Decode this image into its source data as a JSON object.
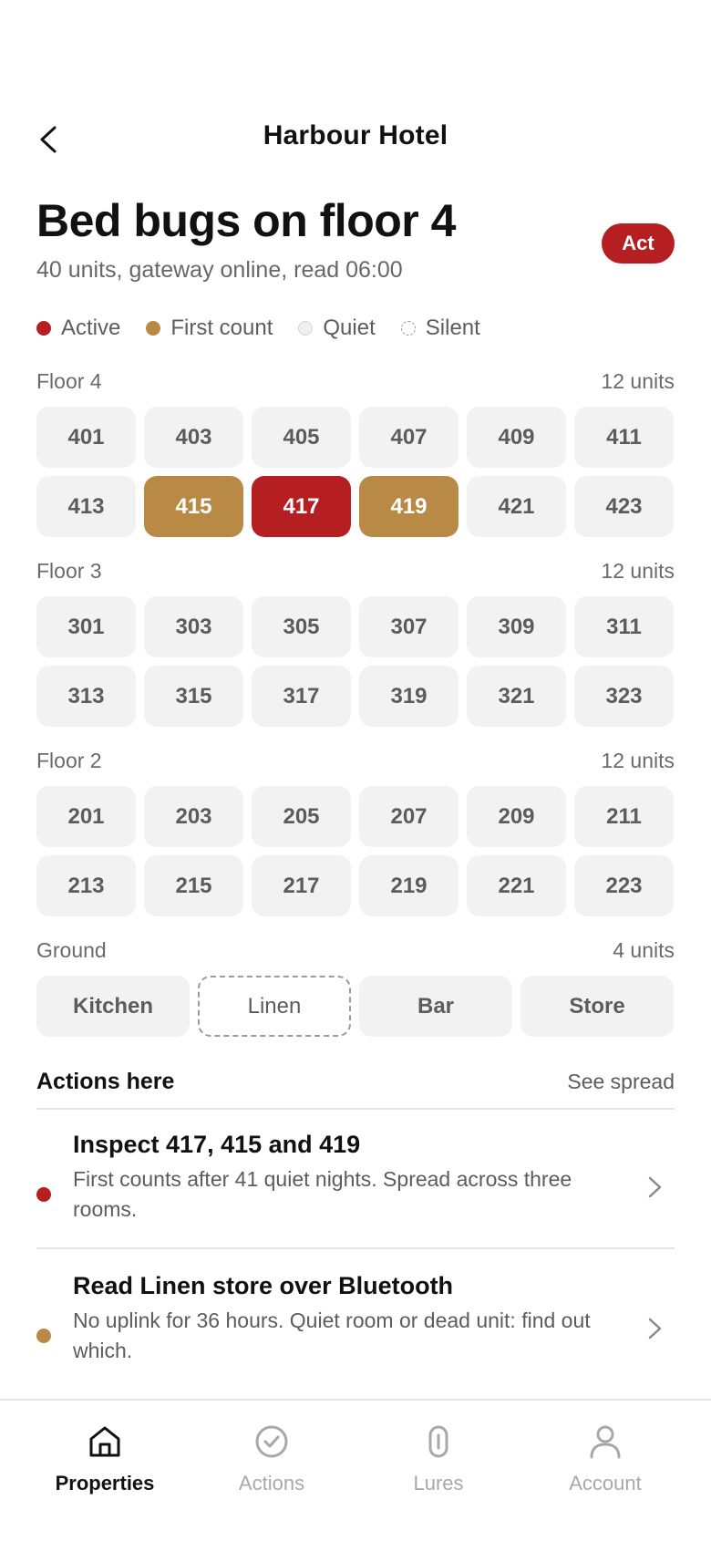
{
  "header": {
    "hotel_name": "Harbour Hotel",
    "title": "Bed bugs on floor 4",
    "subtitle": "40 units, gateway online, read 06:00",
    "badge": "Act",
    "badge_color": "#b51f22"
  },
  "legend": [
    {
      "label": "Active",
      "status": "active",
      "color": "#b51f22"
    },
    {
      "label": "First count",
      "status": "first",
      "color": "#b88a45"
    },
    {
      "label": "Quiet",
      "status": "quiet",
      "color": "#efefef"
    },
    {
      "label": "Silent",
      "status": "silent",
      "color": "#ffffff"
    }
  ],
  "floors": [
    {
      "name": "Floor 4",
      "units": "12 units",
      "rooms": [
        {
          "label": "401",
          "status": "quiet"
        },
        {
          "label": "403",
          "status": "quiet"
        },
        {
          "label": "405",
          "status": "quiet"
        },
        {
          "label": "407",
          "status": "quiet"
        },
        {
          "label": "409",
          "status": "quiet"
        },
        {
          "label": "411",
          "status": "quiet"
        },
        {
          "label": "413",
          "status": "quiet"
        },
        {
          "label": "415",
          "status": "first"
        },
        {
          "label": "417",
          "status": "active"
        },
        {
          "label": "419",
          "status": "first"
        },
        {
          "label": "421",
          "status": "quiet"
        },
        {
          "label": "423",
          "status": "quiet"
        }
      ]
    },
    {
      "name": "Floor 3",
      "units": "12 units",
      "rooms": [
        {
          "label": "301",
          "status": "quiet"
        },
        {
          "label": "303",
          "status": "quiet"
        },
        {
          "label": "305",
          "status": "quiet"
        },
        {
          "label": "307",
          "status": "quiet"
        },
        {
          "label": "309",
          "status": "quiet"
        },
        {
          "label": "311",
          "status": "quiet"
        },
        {
          "label": "313",
          "status": "quiet"
        },
        {
          "label": "315",
          "status": "quiet"
        },
        {
          "label": "317",
          "status": "quiet"
        },
        {
          "label": "319",
          "status": "quiet"
        },
        {
          "label": "321",
          "status": "quiet"
        },
        {
          "label": "323",
          "status": "quiet"
        }
      ]
    },
    {
      "name": "Floor 2",
      "units": "12 units",
      "rooms": [
        {
          "label": "201",
          "status": "quiet"
        },
        {
          "label": "203",
          "status": "quiet"
        },
        {
          "label": "205",
          "status": "quiet"
        },
        {
          "label": "207",
          "status": "quiet"
        },
        {
          "label": "209",
          "status": "quiet"
        },
        {
          "label": "211",
          "status": "quiet"
        },
        {
          "label": "213",
          "status": "quiet"
        },
        {
          "label": "215",
          "status": "quiet"
        },
        {
          "label": "217",
          "status": "quiet"
        },
        {
          "label": "219",
          "status": "quiet"
        },
        {
          "label": "221",
          "status": "quiet"
        },
        {
          "label": "223",
          "status": "quiet"
        }
      ]
    },
    {
      "name": "Ground",
      "units": "4 units",
      "rooms": [
        {
          "label": "Kitchen",
          "status": "quiet"
        },
        {
          "label": "Linen",
          "status": "silent"
        },
        {
          "label": "Bar",
          "status": "quiet"
        },
        {
          "label": "Store",
          "status": "quiet"
        }
      ]
    }
  ],
  "actions": {
    "title": "Actions here",
    "link": "See spread",
    "items": [
      {
        "title": "Inspect 417, 415 and 419",
        "description": "First counts after 41 quiet nights. Spread across three rooms.",
        "color": "#b51f22"
      },
      {
        "title": "Read Linen store over Bluetooth",
        "description": "No uplink for 36 hours. Quiet room or dead unit: find out which.",
        "color": "#b88a45"
      }
    ]
  },
  "nav": [
    {
      "label": "Properties",
      "icon": "home-icon",
      "selected": true
    },
    {
      "label": "Actions",
      "icon": "check-circle-icon",
      "selected": false
    },
    {
      "label": "Lures",
      "icon": "lure-icon",
      "selected": false
    },
    {
      "label": "Account",
      "icon": "person-icon",
      "selected": false
    }
  ]
}
